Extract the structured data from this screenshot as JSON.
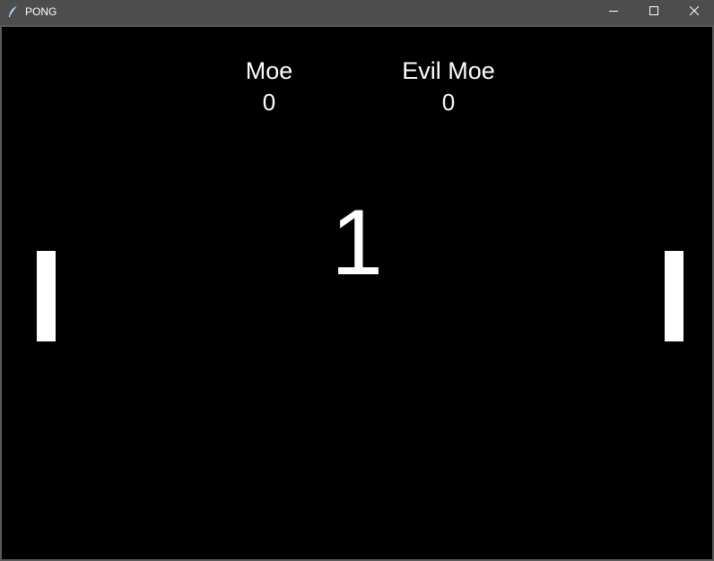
{
  "window": {
    "title": "PONG",
    "icon": "feather-icon",
    "controls": [
      "minimize-icon",
      "maximize-icon",
      "close-icon"
    ]
  },
  "game": {
    "background_color": "#000000",
    "foreground_color": "#ffffff",
    "players": {
      "left": {
        "name": "Moe",
        "score": "0"
      },
      "right": {
        "name": "Evil Moe",
        "score": "0"
      }
    },
    "countdown": "1"
  }
}
